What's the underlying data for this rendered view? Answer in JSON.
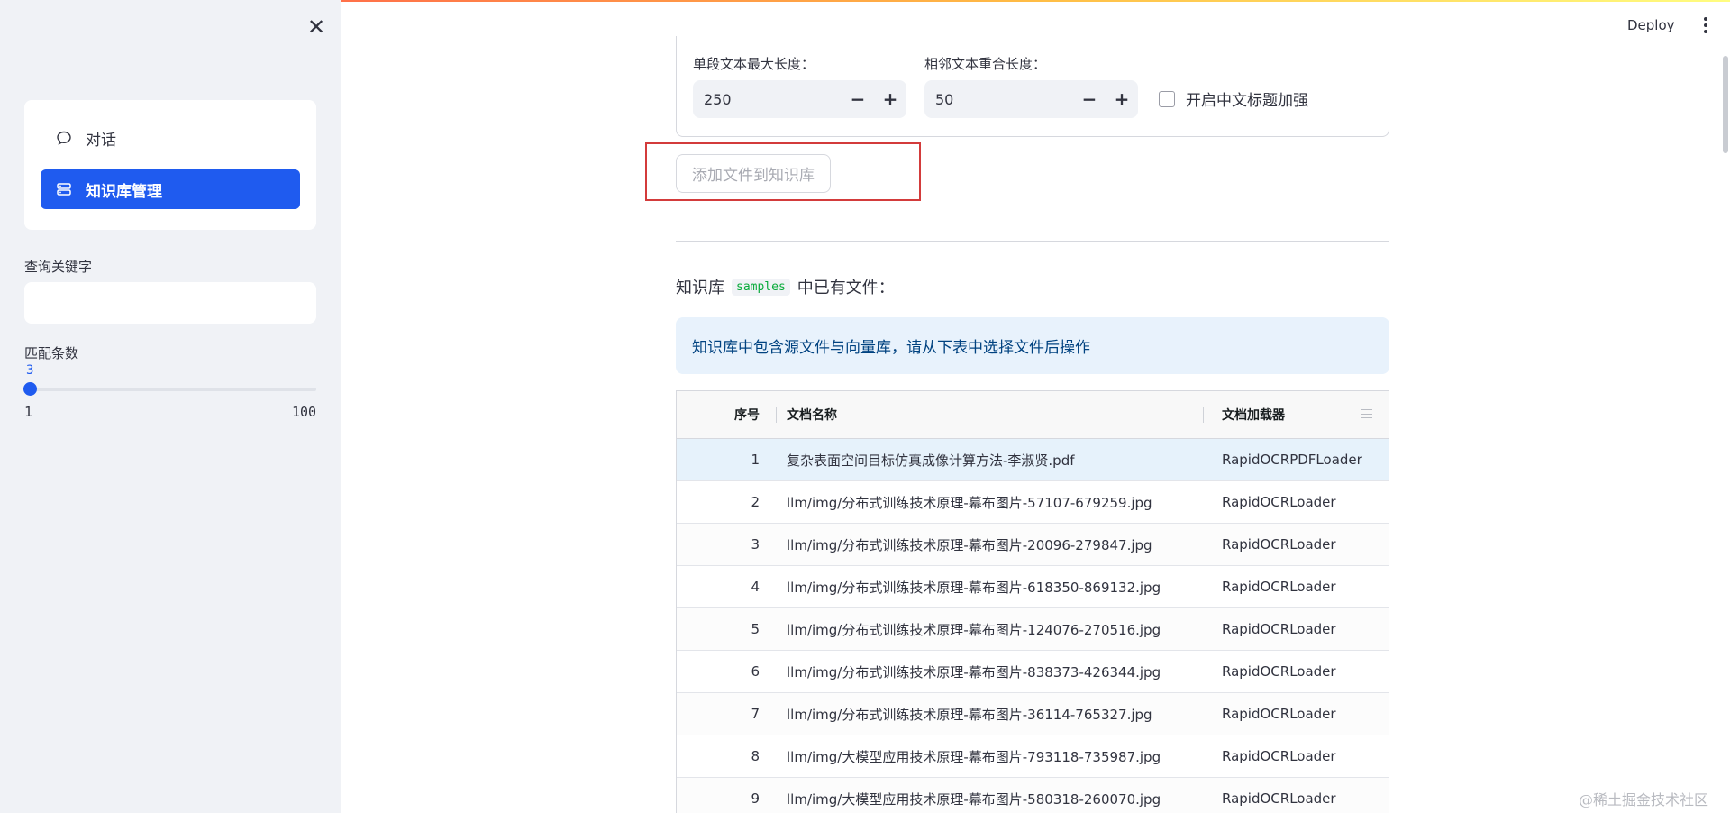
{
  "header": {
    "deploy_label": "Deploy",
    "menu_icon": "more-vertical-icon"
  },
  "sidebar": {
    "close_icon": "close-icon",
    "nav": [
      {
        "label": "对话",
        "icon": "chat-bubble-icon",
        "active": false
      },
      {
        "label": "知识库管理",
        "icon": "database-icon",
        "active": true
      }
    ],
    "search": {
      "label": "查询关键字",
      "value": ""
    },
    "match_count": {
      "label": "匹配条数",
      "value": "3",
      "min": "1",
      "max": "100",
      "fraction": 0.02
    }
  },
  "settings": {
    "chunk_size": {
      "label": "单段文本最大长度：",
      "value": "250"
    },
    "overlap": {
      "label": "相邻文本重合长度：",
      "value": "50"
    },
    "zh_title": {
      "label": "开启中文标题加强",
      "checked": false
    },
    "minus": "−",
    "plus": "+"
  },
  "add_button": "添加文件到知识库",
  "kb_heading": {
    "prefix": "知识库",
    "name": "samples",
    "suffix": "中已有文件："
  },
  "info_text": "知识库中包含源文件与向量库，请从下表中选择文件后操作",
  "table": {
    "columns": [
      "序号",
      "文档名称",
      "文档加载器"
    ],
    "rows": [
      {
        "no": "1",
        "name": "复杂表面空间目标仿真成像计算方法-李淑贤.pdf",
        "loader": "RapidOCRPDFLoader"
      },
      {
        "no": "2",
        "name": "llm/img/分布式训练技术原理-幕布图片-57107-679259.jpg",
        "loader": "RapidOCRLoader"
      },
      {
        "no": "3",
        "name": "llm/img/分布式训练技术原理-幕布图片-20096-279847.jpg",
        "loader": "RapidOCRLoader"
      },
      {
        "no": "4",
        "name": "llm/img/分布式训练技术原理-幕布图片-618350-869132.jpg",
        "loader": "RapidOCRLoader"
      },
      {
        "no": "5",
        "name": "llm/img/分布式训练技术原理-幕布图片-124076-270516.jpg",
        "loader": "RapidOCRLoader"
      },
      {
        "no": "6",
        "name": "llm/img/分布式训练技术原理-幕布图片-838373-426344.jpg",
        "loader": "RapidOCRLoader"
      },
      {
        "no": "7",
        "name": "llm/img/分布式训练技术原理-幕布图片-36114-765327.jpg",
        "loader": "RapidOCRLoader"
      },
      {
        "no": "8",
        "name": "llm/img/大模型应用技术原理-幕布图片-793118-735987.jpg",
        "loader": "RapidOCRLoader"
      },
      {
        "no": "9",
        "name": "llm/img/大模型应用技术原理-幕布图片-580318-260070.jpg",
        "loader": "RapidOCRLoader"
      }
    ]
  },
  "watermark": "@稀土掘金技术社区",
  "colors": {
    "accent": "#1f5bef",
    "highlight": "#d33b3b",
    "info_bg": "#e8f2fc"
  }
}
